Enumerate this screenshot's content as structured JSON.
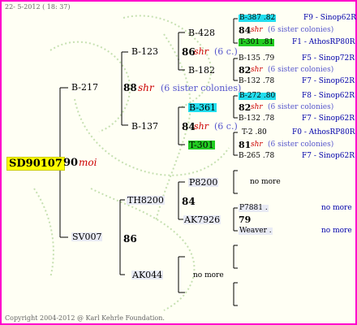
{
  "header": {
    "date": "22-  5-2012 ( 18: 37)"
  },
  "footer": {
    "copyright": "Copyright 2004-2012 @ Karl Kehrle Foundation."
  },
  "gen0": {
    "label": "SD90107"
  },
  "gen1": {
    "num": "90",
    "mark": "moi"
  },
  "gen2": {
    "father": {
      "label": "B-217"
    },
    "mother": {
      "label": "SV007"
    },
    "father_num": "88",
    "father_mark": "shr",
    "father_note": "(6 sister colonies)",
    "mother_num": "86"
  },
  "gen3": {
    "a": {
      "label": "B-123"
    },
    "b": {
      "label": "B-137"
    },
    "c": {
      "label": "TH8200"
    },
    "d": {
      "label": "AK044"
    },
    "a_num": "86",
    "a_mark": "shr",
    "a_note": "(6 c.)",
    "b_num": "84",
    "b_mark": "shr",
    "b_note": "(6 c.)",
    "c_num": "84",
    "d_nomore": "no more"
  },
  "gen4": {
    "a1": "B-428",
    "a2": "B-182",
    "b1": "B-361",
    "b2": "T-301",
    "c1": "P8200",
    "c2": "AK7926",
    "c1_nomore": "no more"
  },
  "gen5": [
    {
      "label": "B-387 .82",
      "origin": "F9 - Sinop62R"
    },
    {
      "num": "84",
      "mark": "shr",
      "note": "(6 sister colonies)"
    },
    {
      "label": "T-301 .81",
      "origin": "F1 - AthosRP80R"
    },
    {
      "label": "B-135 .79",
      "origin": "F5 - Sinop72R"
    },
    {
      "num": "82",
      "mark": "shr",
      "note": "(6 sister colonies)"
    },
    {
      "label": "B-132 .78",
      "origin": "F7 - Sinop62R"
    },
    {
      "label": "B-272 .80",
      "origin": "F8 - Sinop62R"
    },
    {
      "num": "82",
      "mark": "shr",
      "note": "(6 sister colonies)"
    },
    {
      "label": "B-132 .78",
      "origin": "F7 - Sinop62R"
    },
    {
      "label": "T-2 .80",
      "origin": "F0 - AthosRP80R"
    },
    {
      "num": "81",
      "mark": "shr",
      "note": "(6 sister colonies)"
    },
    {
      "label": "B-265 .78",
      "origin": "F7 - Sinop62R"
    },
    {
      "label": "P7881 .",
      "origin": "no more"
    },
    {
      "num": "79"
    },
    {
      "label": "Weaver .",
      "origin": "no more"
    }
  ]
}
